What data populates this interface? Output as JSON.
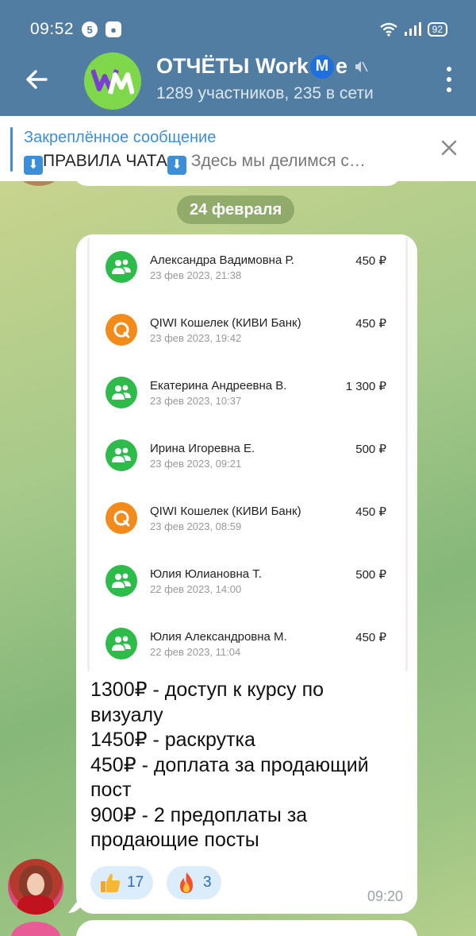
{
  "status_bar": {
    "time": "09:52",
    "notif_icon_1": "5",
    "battery": "92",
    "icons": [
      "wifi-icon",
      "signal-icon",
      "battery-icon"
    ]
  },
  "header": {
    "title_prefix": "ОТЧЁТЫ Work",
    "title_badge": "M",
    "title_suffix": "e",
    "subtitle": "1289 участников, 235 в сети",
    "avatar_initials": "WM",
    "colors": {
      "bar": "#527da3",
      "avatar_bg": "#7fd84a"
    }
  },
  "pinned": {
    "label": "Закреплённое сообщение",
    "text_main": "ПРАВИЛА ЧАТА",
    "text_rest": "Здесь мы делимся с…"
  },
  "chat": {
    "date_separator": "24 февраля",
    "message": {
      "transactions": [
        {
          "name": "Александра Вадимовна Р.",
          "date": "23 фев 2023, 21:38",
          "amount": "450 ₽",
          "icon": "transfer-icon"
        },
        {
          "name": "QIWI Кошелек (КИВИ Банк)",
          "date": "23 фев 2023, 19:42",
          "amount": "450 ₽",
          "icon": "qiwi-icon"
        },
        {
          "name": "Екатерина Андреевна В.",
          "date": "23 фев 2023, 10:37",
          "amount": "1 300 ₽",
          "icon": "transfer-icon"
        },
        {
          "name": "Ирина Игоревна Е.",
          "date": "23 фев 2023, 09:21",
          "amount": "500 ₽",
          "icon": "transfer-icon"
        },
        {
          "name": "QIWI Кошелек (КИВИ Банк)",
          "date": "23 фев 2023, 08:59",
          "amount": "450 ₽",
          "icon": "qiwi-icon"
        },
        {
          "name": "Юлия Юлиановна Т.",
          "date": "22 фев 2023, 14:00",
          "amount": "500 ₽",
          "icon": "transfer-icon"
        },
        {
          "name": "Юлия Александровна М.",
          "date": "22 фев 2023, 11:04",
          "amount": "450 ₽",
          "icon": "transfer-icon"
        }
      ],
      "text_lines": [
        "1300₽ - доступ к курсу по",
        "визуалу",
        "1450₽ - раскрутка",
        "450₽ - доплата за продающий",
        "пост",
        "900₽ - 2 предоплаты за",
        "продающие посты"
      ],
      "reactions": [
        {
          "emoji": "thumbs-up-icon",
          "count": "17"
        },
        {
          "emoji": "fire-icon",
          "count": "3"
        }
      ],
      "time": "09:20"
    }
  }
}
